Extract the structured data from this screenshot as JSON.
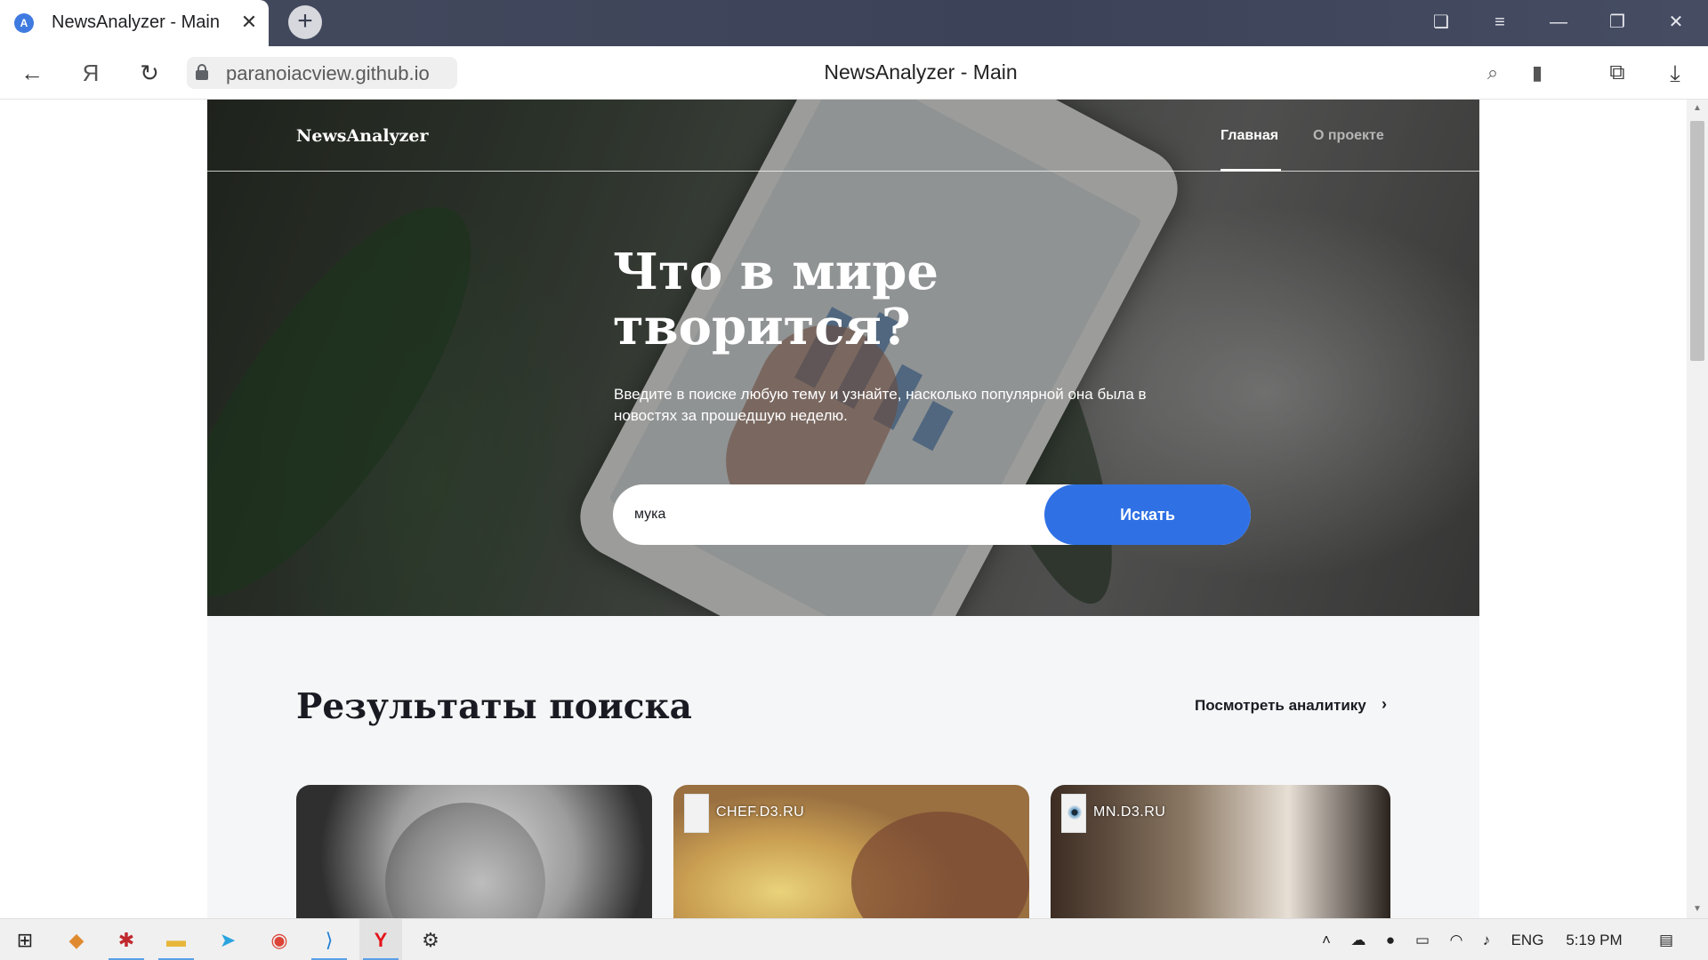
{
  "browser": {
    "tab": {
      "title": "NewsAnalyzer - Main",
      "favicon_letter": "A"
    },
    "new_tab_symbol": "+",
    "url": "paranoiacview.github.io",
    "page_title": "NewsAnalyzer - Main",
    "yandex_symbol": "Я"
  },
  "site": {
    "brand": "NewsAnalyzer",
    "nav": {
      "main": "Главная",
      "about": "О проекте"
    },
    "hero": {
      "title": "Что в мире творится?",
      "subtitle": "Введите в поиске любую тему и узнайте, насколько популярной она была в новостях за прошедшую неделю."
    },
    "search": {
      "value": "мука",
      "button": "Искать"
    },
    "results": {
      "title": "Результаты поиска",
      "analytics_link": "Посмотреть аналитику",
      "cards": [
        {
          "source_label": ""
        },
        {
          "source_label": "CHEF.D3.RU"
        },
        {
          "source_label": "MN.D3.RU"
        }
      ]
    },
    "colors": {
      "accent": "#2f71e5",
      "results_bg": "#f5f6f7"
    }
  },
  "taskbar": {
    "language": "ENG",
    "time": "5:19 PM",
    "yandex_app_symbol": "Y"
  }
}
